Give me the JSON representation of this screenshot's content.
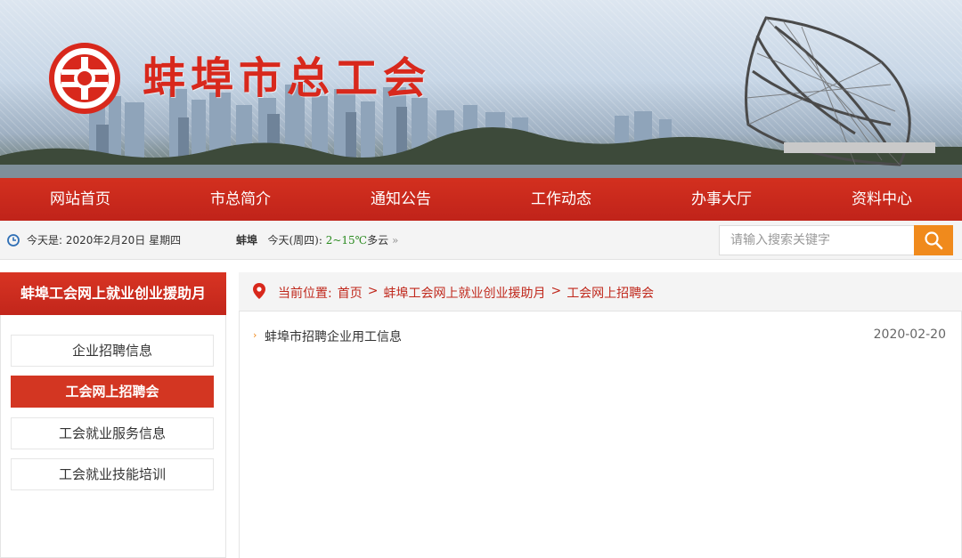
{
  "site": {
    "title": "蚌埠市总工会"
  },
  "nav": [
    "网站首页",
    "市总简介",
    "通知公告",
    "工作动态",
    "办事大厅",
    "资料中心"
  ],
  "infobar": {
    "date": "今天是: 2020年2月20日 星期四",
    "city": "蚌埠",
    "weather_day": "今天(周四):",
    "temp": "2~15℃",
    "weather": "多云",
    "arrow": "»"
  },
  "search": {
    "placeholder": "请输入搜索关键字"
  },
  "sidebar": {
    "title": "蚌埠工会网上就业创业援助月",
    "items": [
      {
        "label": "企业招聘信息",
        "active": false
      },
      {
        "label": "工会网上招聘会",
        "active": true
      },
      {
        "label": "工会就业服务信息",
        "active": false
      },
      {
        "label": "工会就业技能培训",
        "active": false
      }
    ]
  },
  "breadcrumb": {
    "prefix": "当前位置:",
    "items": [
      "首页",
      "蚌埠工会网上就业创业援助月",
      "工会网上招聘会"
    ],
    "sep": ">"
  },
  "list": [
    {
      "title": "蚌埠市招聘企业用工信息",
      "date": "2020-02-20"
    }
  ],
  "colors": {
    "primary_red": "#c0231a",
    "accent_orange": "#f08a1c"
  }
}
